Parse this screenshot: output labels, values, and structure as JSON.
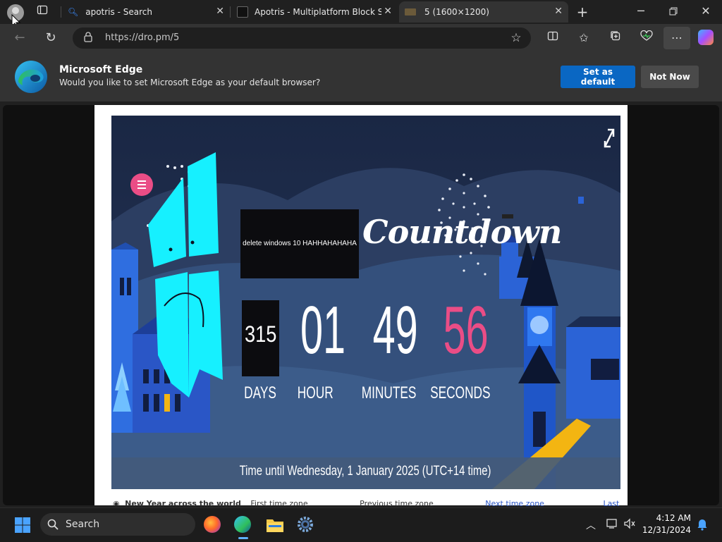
{
  "tabs": [
    {
      "title": "apotris - Search",
      "icon": "search-icon"
    },
    {
      "title": "Apotris - Multiplatform Block Stac",
      "icon": "apotris-logo-icon"
    },
    {
      "title": "5 (1600×1200)",
      "icon": "image-icon"
    }
  ],
  "address": {
    "url": "https://dro.pm/5"
  },
  "infobar": {
    "title": "Microsoft Edge",
    "message": "Would you like to set Microsoft Edge as your default browser?",
    "set_default_label": "Set as default",
    "not_now_label": "Not Now"
  },
  "countdown": {
    "note_box": "delete windows 10 HAHHAHAHAHA",
    "title": "Countdown",
    "days": "315",
    "hours": "01",
    "minutes": "49",
    "seconds": "56",
    "days_label": "DAYS",
    "hours_label": "HOUR",
    "minutes_label": "MINUTES",
    "seconds_label": "SECONDS",
    "footer": "Time until Wednesday, 1 January 2025 (UTC+14 time)"
  },
  "below_image": {
    "heading": "New Year across the world",
    "first_zone": "First time zone",
    "prev_zone": "Previous time zone",
    "next_zone": "Next time zone",
    "last_zone": "Last time zone"
  },
  "taskbar": {
    "search_label": "Search",
    "time": "4:12 AM",
    "date": "12/31/2024"
  },
  "colors": {
    "accent": "#0a67c3",
    "cyan_drawing": "#16f0ff",
    "seconds_pink": "#ea4d86",
    "window_yellow": "#f3b512"
  }
}
